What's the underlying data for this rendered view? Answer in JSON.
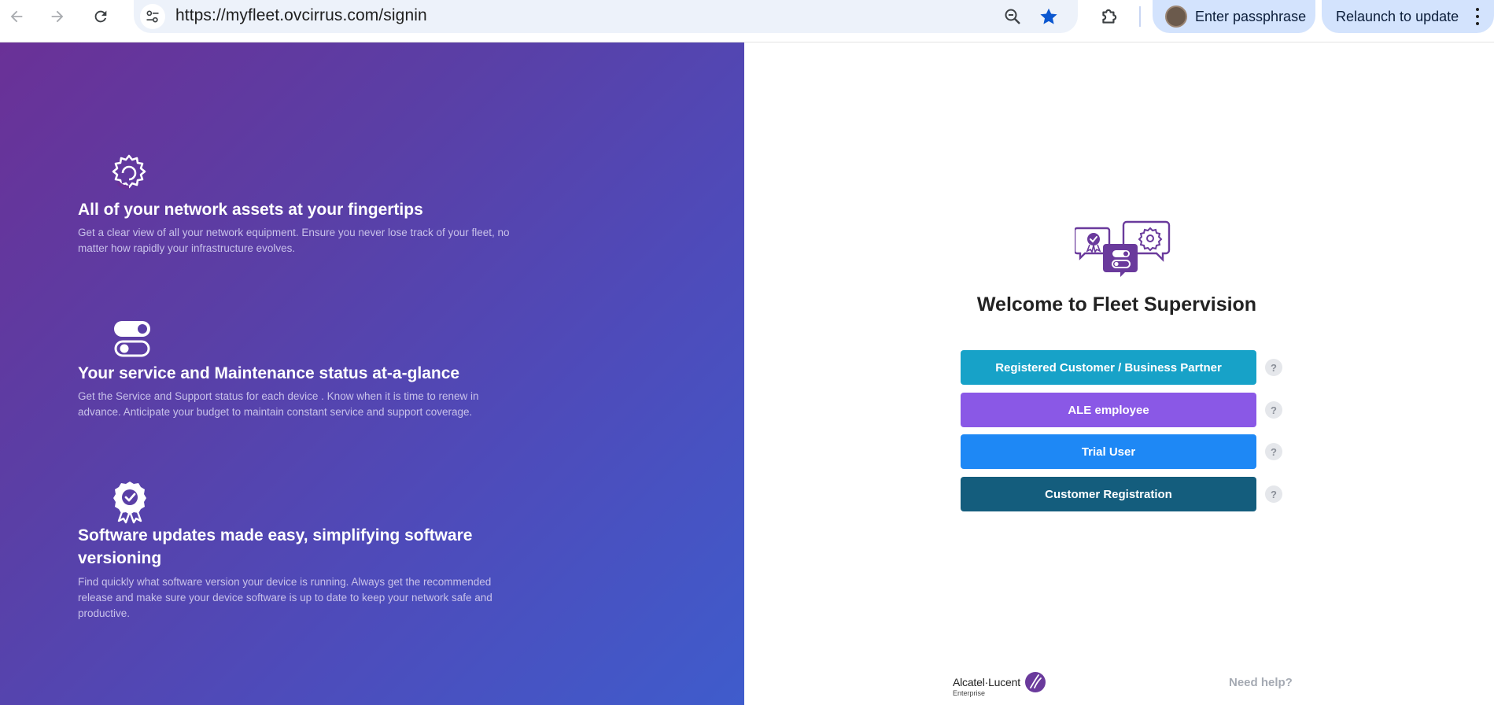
{
  "browser": {
    "url": "https://myfleet.ovcirrus.com/signin",
    "passphrase_label": "Enter passphrase",
    "relaunch_label": "Relaunch to update"
  },
  "features": [
    {
      "icon": "gear-icon",
      "title": "All of your network assets at your fingertips",
      "body": "Get a clear view of all your network equipment. Ensure you never lose track of your fleet, no matter how rapidly your infrastructure evolves."
    },
    {
      "icon": "toggle-icon",
      "title": "Your service and Maintenance status at-a-glance",
      "body": "Get the Service and Support status for each device . Know when it is time to renew in advance. Anticipate your budget to maintain constant service and support coverage."
    },
    {
      "icon": "badge-icon",
      "title": "Software updates made easy, simplifying software versioning",
      "body": "Find quickly what software version your device is running. Always get the recommended release and make sure your device software is up to date to keep your network safe and productive."
    }
  ],
  "signin": {
    "title": "Welcome to Fleet Supervision",
    "buttons": [
      {
        "label": "Registered Customer / Business Partner",
        "color": "#17a2c8"
      },
      {
        "label": "ALE employee",
        "color": "#8a58e6"
      },
      {
        "label": "Trial User",
        "color": "#1e88f5"
      },
      {
        "label": "Customer Registration",
        "color": "#145d7d"
      }
    ],
    "help_glyph": "?",
    "need_help": "Need help?"
  },
  "brand": {
    "name": "Alcatel·Lucent",
    "sub": "Enterprise",
    "color": "#6a3a9c"
  }
}
